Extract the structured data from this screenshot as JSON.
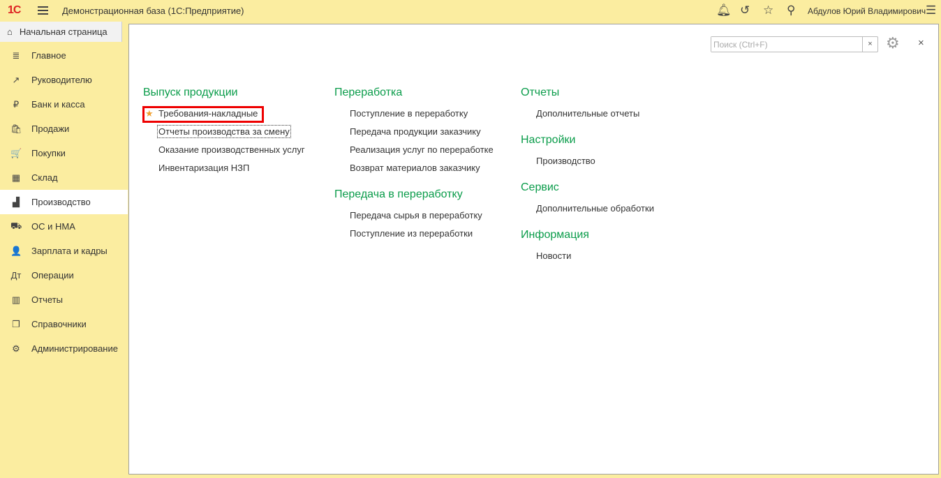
{
  "app": {
    "logo": "1С",
    "title": "Демонстрационная база  (1С:Предприятие)",
    "user": "Абдулов Юрий Владимирович"
  },
  "home_tab": {
    "label": "Начальная страница"
  },
  "sidebar": {
    "items": [
      {
        "label": "Главное",
        "icon": "≣"
      },
      {
        "label": "Руководителю",
        "icon": "↗"
      },
      {
        "label": "Банк и касса",
        "icon": "₽"
      },
      {
        "label": "Продажи",
        "icon": "🛍"
      },
      {
        "label": "Покупки",
        "icon": "🛒"
      },
      {
        "label": "Склад",
        "icon": "▦"
      },
      {
        "label": "Производство",
        "icon": "▟"
      },
      {
        "label": "ОС и НМА",
        "icon": "⛟"
      },
      {
        "label": "Зарплата и кадры",
        "icon": "👤"
      },
      {
        "label": "Операции",
        "icon": "Дт"
      },
      {
        "label": "Отчеты",
        "icon": "▥"
      },
      {
        "label": "Справочники",
        "icon": "❐"
      },
      {
        "label": "Администрирование",
        "icon": "⚙"
      }
    ],
    "active": "Производство"
  },
  "search": {
    "placeholder": "Поиск (Ctrl+F)",
    "clear": "×"
  },
  "main": {
    "close": "×",
    "columns": [
      [
        {
          "title": "Выпуск продукции",
          "links": [
            "Требования-накладные",
            "Отчеты производства за смену",
            "Оказание производственных услуг",
            "Инвентаризация НЗП"
          ]
        }
      ],
      [
        {
          "title": "Переработка",
          "links": [
            "Поступление в переработку",
            "Передача продукции заказчику",
            "Реализация услуг по переработке",
            "Возврат материалов заказчику"
          ]
        },
        {
          "title": "Передача в переработку",
          "links": [
            "Передача сырья в переработку",
            "Поступление из переработки"
          ]
        }
      ],
      [
        {
          "title": "Отчеты",
          "links": [
            "Дополнительные отчеты"
          ]
        },
        {
          "title": "Настройки",
          "links": [
            "Производство"
          ]
        },
        {
          "title": "Сервис",
          "links": [
            "Дополнительные обработки"
          ]
        },
        {
          "title": "Информация",
          "links": [
            "Новости"
          ]
        }
      ]
    ]
  }
}
